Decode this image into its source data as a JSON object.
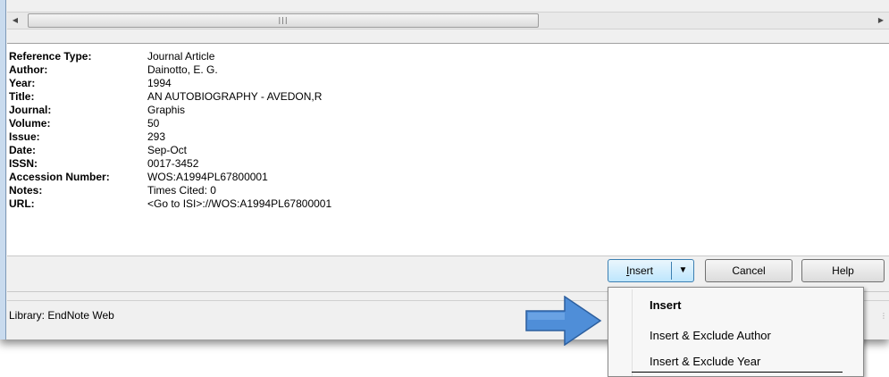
{
  "reference": {
    "fields": [
      {
        "label": "Reference Type:",
        "value": "Journal Article"
      },
      {
        "label": "Author:",
        "value": "Dainotto, E. G."
      },
      {
        "label": "Year:",
        "value": "1994"
      },
      {
        "label": "Title:",
        "value": "AN AUTOBIOGRAPHY - AVEDON,R"
      },
      {
        "label": "Journal:",
        "value": "Graphis"
      },
      {
        "label": "Volume:",
        "value": "50"
      },
      {
        "label": "Issue:",
        "value": "293"
      },
      {
        "label": "Date:",
        "value": "Sep-Oct"
      },
      {
        "label": "ISSN:",
        "value": "0017-3452"
      },
      {
        "label": "Accession Number:",
        "value": "WOS:A1994PL67800001"
      },
      {
        "label": "Notes:",
        "value": "Times Cited: 0"
      },
      {
        "label": "URL:",
        "value": "<Go to ISI>://WOS:A1994PL67800001"
      }
    ]
  },
  "buttons": {
    "insert": {
      "underlined": "I",
      "rest": "nsert"
    },
    "cancel": "Cancel",
    "help": "Help"
  },
  "status": "Library: EndNote Web",
  "menu": {
    "items": [
      "Insert",
      "Insert & Exclude Author",
      "Insert & Exclude Year"
    ]
  },
  "icons": {
    "scroll_left": "scroll-left-arrow-icon",
    "scroll_right": "scroll-right-arrow-icon",
    "dropdown": "dropdown-arrow-icon",
    "pointer": "pointer-arrow-icon"
  },
  "colors": {
    "arrow_fill": "#4f8ed8",
    "window_bg": "#f0f0f0",
    "insert_border": "#3c7fb1"
  }
}
